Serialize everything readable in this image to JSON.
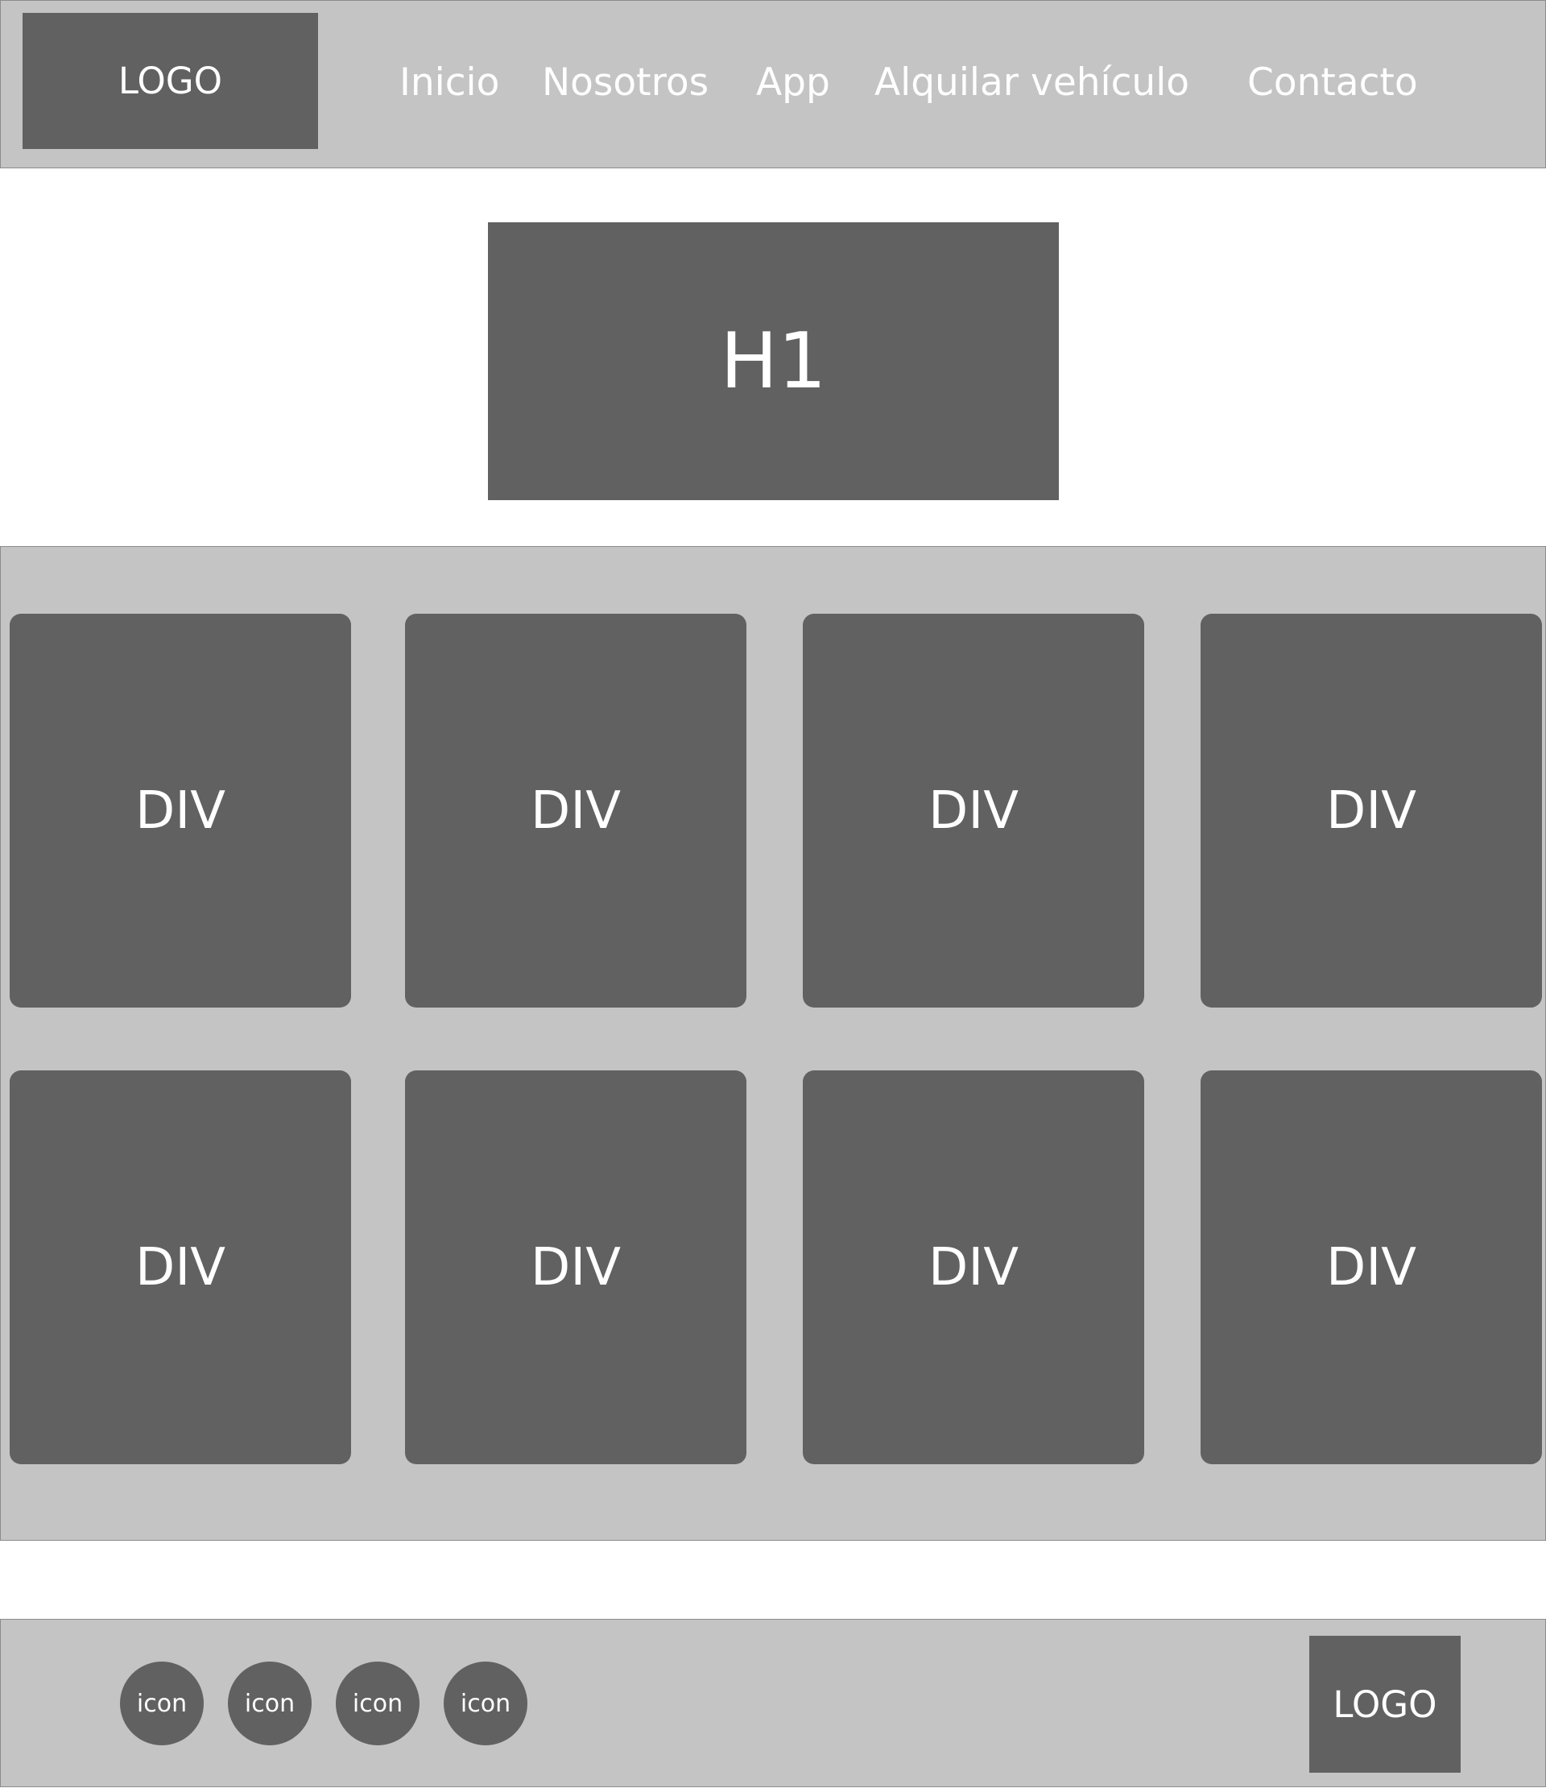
{
  "header": {
    "logo": "LOGO",
    "nav": [
      "Inicio",
      "Nosotros",
      "App",
      "Alquilar vehículo",
      "Contacto"
    ]
  },
  "hero": {
    "title": "H1"
  },
  "grid": {
    "items": [
      "DIV",
      "DIV",
      "DIV",
      "DIV",
      "DIV",
      "DIV",
      "DIV",
      "DIV"
    ]
  },
  "footer": {
    "icons": [
      "icon",
      "icon",
      "icon",
      "icon"
    ],
    "logo": "LOGO"
  },
  "colors": {
    "panel": "#c4c4c4",
    "block": "#616161",
    "text": "#ffffff",
    "background": "#ffffff"
  }
}
